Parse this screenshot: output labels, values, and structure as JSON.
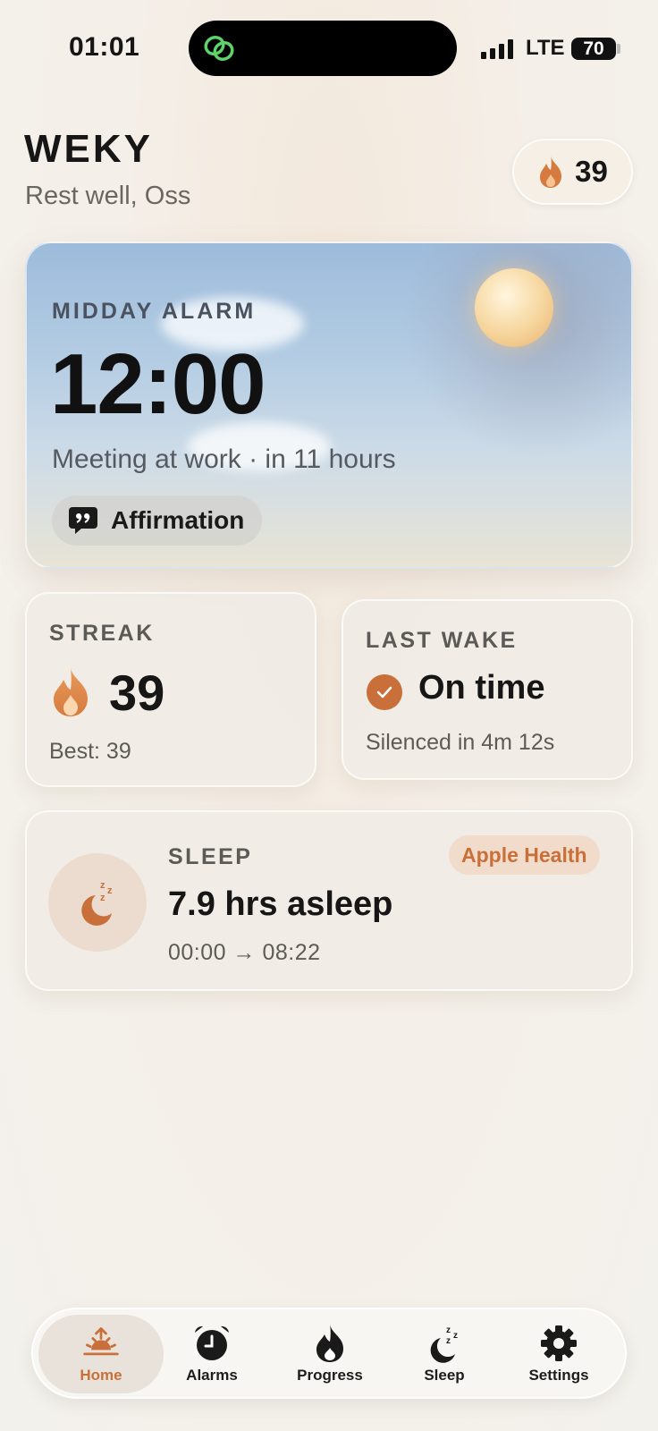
{
  "status_bar": {
    "time": "01:01",
    "network": "LTE",
    "battery": "70"
  },
  "header": {
    "title": "WEKY",
    "subtitle": "Rest well, Oss",
    "streak_count": "39"
  },
  "alarm": {
    "label": "MIDDAY ALARM",
    "time": "12:00",
    "detail": "Meeting at work · in 11 hours",
    "chip_label": "Affirmation"
  },
  "streak_card": {
    "label": "STREAK",
    "value": "39",
    "best": "Best: 39"
  },
  "wake_card": {
    "label": "LAST WAKE",
    "status": "On time",
    "detail": "Silenced in 4m 12s"
  },
  "sleep_card": {
    "label": "SLEEP",
    "value": "7.9 hrs asleep",
    "range": "00:00 → 08:22",
    "source_badge": "Apple Health"
  },
  "tabbar": {
    "tabs": [
      {
        "label": "Home",
        "icon": "sunrise-icon",
        "active": true
      },
      {
        "label": "Alarms",
        "icon": "alarm-clock-icon",
        "active": false
      },
      {
        "label": "Progress",
        "icon": "flame-icon",
        "active": false
      },
      {
        "label": "Sleep",
        "icon": "moon-zzz-icon",
        "active": false
      },
      {
        "label": "Settings",
        "icon": "gear-icon",
        "active": false
      }
    ]
  },
  "colors": {
    "accent": "#c9703a",
    "text": "#161616",
    "muted": "#5e5b56"
  }
}
